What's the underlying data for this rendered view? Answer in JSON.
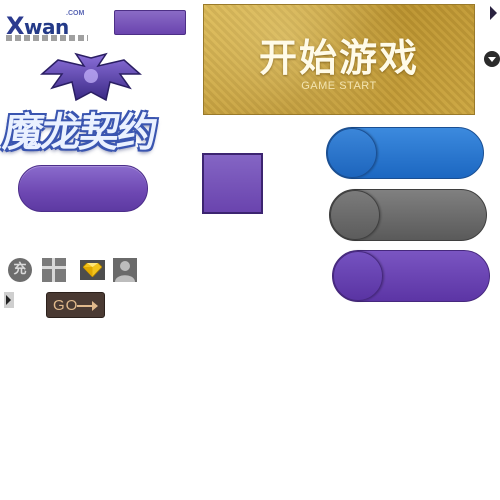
{
  "logo": {
    "brand_x": "X",
    "brand_rest": "wan",
    "domain_suffix": ".COM"
  },
  "game_logo": {
    "title": "魔龙契约"
  },
  "game_start": {
    "title": "开始游戏",
    "subtitle": "GAME START"
  },
  "icons": {
    "recharge_glyph": "充",
    "gift": "gift-icon",
    "diamond": "diamond-icon",
    "user": "user-icon"
  },
  "go_button": {
    "label": "GO"
  },
  "colors": {
    "purple": "#6d47b2",
    "blue": "#1c67c1",
    "gray": "#5a5a5a",
    "gold": "#c9a443",
    "go_bg": "#4a3a33"
  }
}
